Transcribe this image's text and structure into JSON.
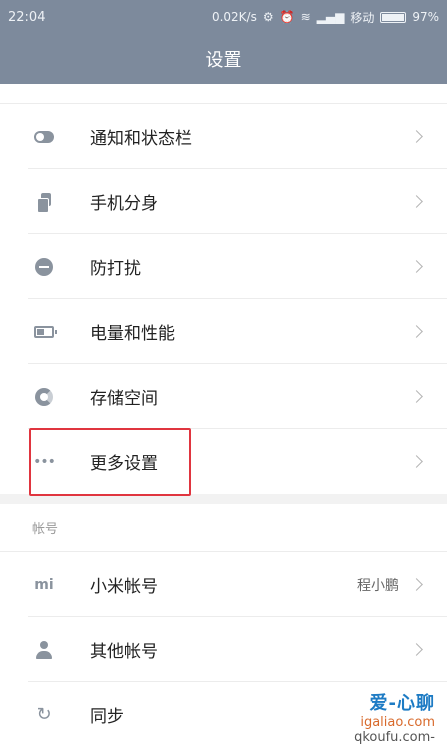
{
  "status_bar": {
    "time": "22:04",
    "net_speed": "0.02K/s",
    "carrier": "移动",
    "battery_percent": "97%",
    "battery_level": 0.97
  },
  "title_bar": {
    "title": "设置"
  },
  "settings": [
    {
      "label": "通知和状态栏",
      "icon": "toggle-icon"
    },
    {
      "label": "手机分身",
      "icon": "phone-clone-icon"
    },
    {
      "label": "防打扰",
      "icon": "do-not-disturb-icon"
    },
    {
      "label": "电量和性能",
      "icon": "battery-icon"
    },
    {
      "label": "存储空间",
      "icon": "storage-icon"
    },
    {
      "label": "更多设置",
      "icon": "more-dots-icon",
      "highlighted": true
    }
  ],
  "accounts_section": {
    "header": "帐号",
    "items": [
      {
        "label": "小米帐号",
        "value": "程小鹏",
        "icon": "mi-icon"
      },
      {
        "label": "其他帐号",
        "icon": "person-icon"
      },
      {
        "label": "同步",
        "icon": "sync-icon"
      }
    ]
  },
  "watermark": {
    "brand": "爱-心聊",
    "domain": "igaliao.com",
    "url": "qkoufu.com-"
  },
  "colors": {
    "header_bg": "#7d8a9c",
    "highlight": "#e0353f",
    "icon": "#8a939e"
  }
}
